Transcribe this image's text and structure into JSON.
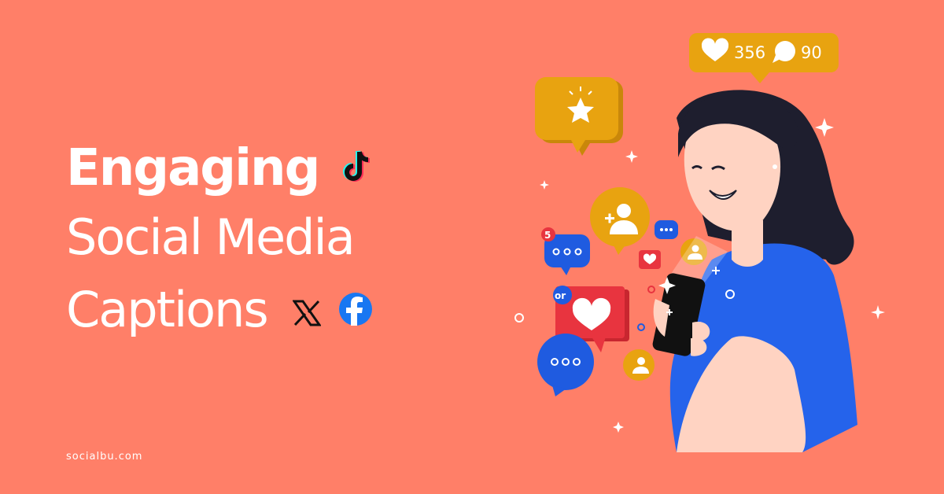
{
  "headline": {
    "line1": "Engaging",
    "line2": "Social Media",
    "line3": "Captions"
  },
  "footer": {
    "domain": "socialbu.com"
  },
  "stats": {
    "likes": "356",
    "comments": "90"
  },
  "badge_or": "or",
  "badge_count": "5",
  "icons": [
    "tiktok-icon",
    "x-logo-icon",
    "facebook-icon",
    "heart-icon",
    "comment-icon",
    "star-icon",
    "add-user-icon",
    "ellipsis-icon",
    "sparkle-icon"
  ],
  "colors": {
    "background": "#FF7F68",
    "text": "#FFFFFF",
    "yellow": "#E8A310",
    "blue": "#1F5BE0",
    "red": "#E8343F",
    "shirt": "#2563EB",
    "hair": "#1E1E2E",
    "skin": "#FFD3C2"
  }
}
